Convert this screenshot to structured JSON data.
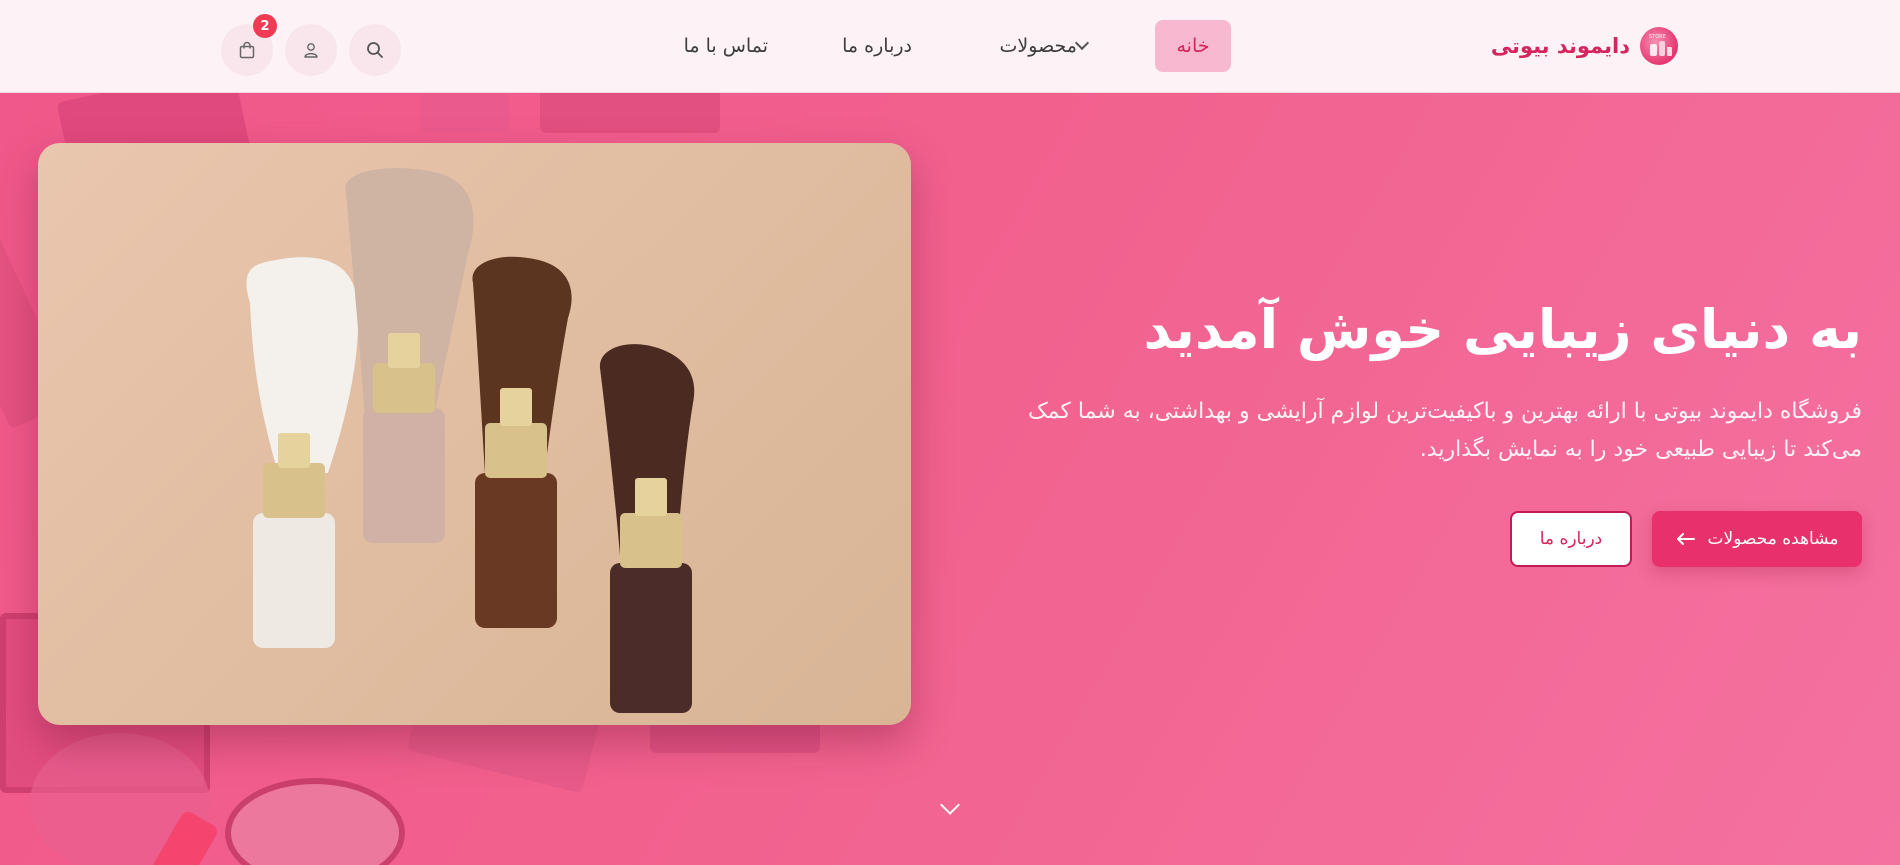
{
  "brand": {
    "name": "دایموند بیوتی",
    "logo_text": "STORE"
  },
  "nav": {
    "home": "خانه",
    "products": "محصولات",
    "about": "درباره ما",
    "contact": "تماس با ما"
  },
  "icons": {
    "search": "search-icon",
    "user": "user-icon",
    "cart": "shopping-bag-icon",
    "chevron": "chevron-down-icon",
    "arrow": "arrow-left-icon"
  },
  "cart": {
    "count": "2"
  },
  "hero": {
    "title": "به دنیای زیبایی خوش آمدید",
    "description": "فروشگاه دایموند بیوتی با ارائه بهترین و باکیفیت‌ترین لوازم آرایشی و بهداشتی، به شما کمک می‌کند تا زیبایی طبیعی خود را به نمایش بگذارید.",
    "primary_button": "مشاهده محصولات",
    "secondary_button": "درباره ما"
  },
  "colors": {
    "accent": "#e8306c",
    "brand_text": "#d6245c",
    "hero_bg": "#f2628f",
    "header_bg": "#fdf3f6",
    "badge": "#ef3b53"
  }
}
